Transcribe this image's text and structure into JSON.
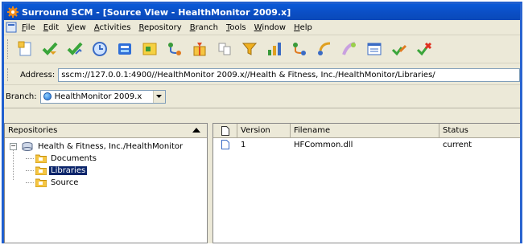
{
  "window": {
    "title": "Surround SCM - [Source View - HealthMonitor 2009.x]",
    "title_icon": "surround-scm-gear-icon"
  },
  "menu": {
    "items": [
      "File",
      "Edit",
      "View",
      "Activities",
      "Repository",
      "Branch",
      "Tools",
      "Window",
      "Help"
    ]
  },
  "toolbar": {
    "buttons": [
      "add-file-icon",
      "get-icon",
      "check-out-icon",
      "history-icon",
      "branch-icon",
      "shelve-icon",
      "merge-icon",
      "label-icon",
      "share-icon",
      "filter-icon",
      "reports-icon",
      "promote-icon",
      "rebase-icon",
      "duplicate-icon",
      "properties-icon",
      "review-icon",
      "attach-icon"
    ]
  },
  "address": {
    "label": "Address:",
    "value": "sscm://127.0.0.1:4900//HealthMonitor 2009.x//Health & Fitness, Inc./HealthMonitor/Libraries/"
  },
  "branch": {
    "label": "Branch:",
    "selected": "HealthMonitor 2009.x"
  },
  "repositories": {
    "header": "Repositories",
    "root": {
      "label": "Health & Fitness, Inc./HealthMonitor",
      "expander": "−"
    },
    "children": [
      {
        "label": "Documents",
        "selected": false
      },
      {
        "label": "Libraries",
        "selected": true
      },
      {
        "label": "Source",
        "selected": false
      }
    ]
  },
  "files": {
    "columns": {
      "version": "Version",
      "filename": "Filename",
      "status": "Status"
    },
    "rows": [
      {
        "version": "1",
        "filename": "HFCommon.dll",
        "status": "current"
      }
    ]
  },
  "colors": {
    "titlebar": "#0a5ad8",
    "selection": "#0a246a",
    "chrome": "#ece9d8"
  }
}
